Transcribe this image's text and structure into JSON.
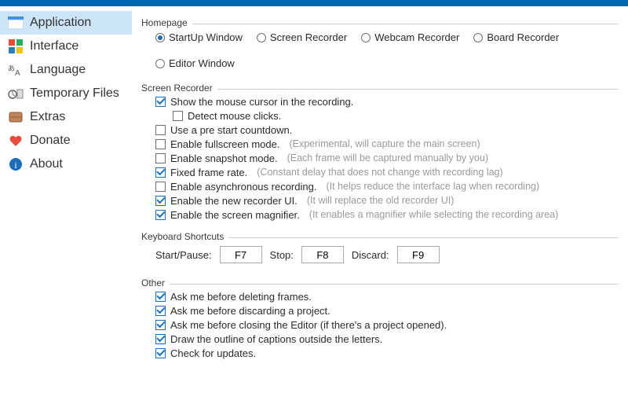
{
  "sidebar": {
    "items": [
      {
        "label": "Application"
      },
      {
        "label": "Interface"
      },
      {
        "label": "Language"
      },
      {
        "label": "Temporary Files"
      },
      {
        "label": "Extras"
      },
      {
        "label": "Donate"
      },
      {
        "label": "About"
      }
    ]
  },
  "groups": {
    "homepage": {
      "title": "Homepage",
      "options": [
        {
          "label": "StartUp Window"
        },
        {
          "label": "Screen Recorder"
        },
        {
          "label": "Webcam Recorder"
        },
        {
          "label": "Board Recorder"
        },
        {
          "label": "Editor Window"
        }
      ]
    },
    "screenRecorder": {
      "title": "Screen Recorder",
      "opts": {
        "cursor": "Show the mouse cursor in the recording.",
        "clicks": "Detect mouse clicks.",
        "countdown": "Use a pre start countdown.",
        "fullscreen": "Enable fullscreen mode.",
        "fullscreen_hint": "(Experimental, will capture the main screen)",
        "snapshot": "Enable snapshot mode.",
        "snapshot_hint": "(Each frame will be captured manually by you)",
        "fixedrate": "Fixed frame rate.",
        "fixedrate_hint": "(Constant delay that does not change with recording lag)",
        "async": "Enable asynchronous recording.",
        "async_hint": "(It helps reduce the interface lag when recording)",
        "newui": "Enable the new recorder UI.",
        "newui_hint": "(It will replace the old recorder UI)",
        "magnifier": "Enable the screen magnifier.",
        "magnifier_hint": "(It enables a magnifier while selecting the recording area)"
      }
    },
    "keyboard": {
      "title": "Keyboard Shortcuts",
      "start_label": "Start/Pause:",
      "start_value": "F7",
      "stop_label": "Stop:",
      "stop_value": "F8",
      "discard_label": "Discard:",
      "discard_value": "F9"
    },
    "other": {
      "title": "Other",
      "opts": {
        "del_frames": "Ask me before deleting frames.",
        "discard_proj": "Ask me before discarding a project.",
        "close_editor": "Ask me before closing the Editor (if there's a project opened).",
        "captions": "Draw the outline of captions outside the letters.",
        "updates": "Check for updates."
      }
    }
  }
}
